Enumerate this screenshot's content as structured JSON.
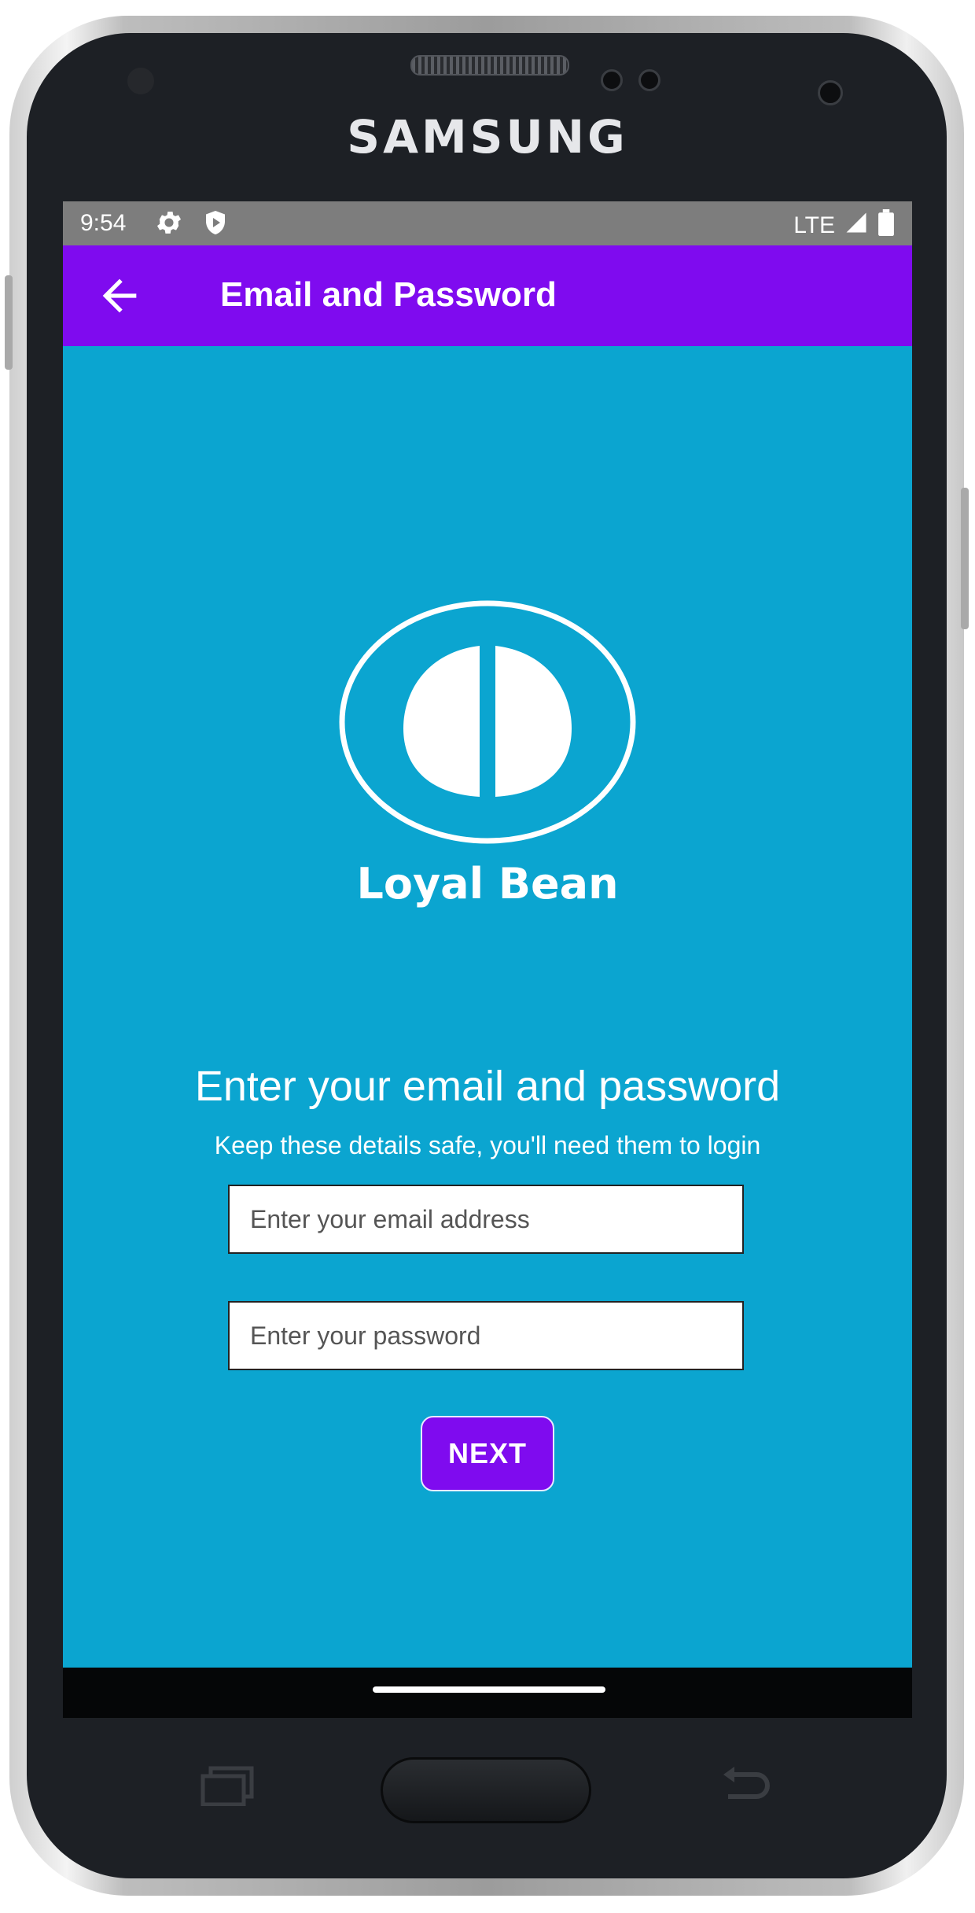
{
  "device": {
    "brand": "SAMSUNG"
  },
  "status_bar": {
    "time": "9:54",
    "network": "LTE",
    "icons": [
      "gear-icon",
      "shield-icon",
      "signal-icon",
      "battery-icon"
    ]
  },
  "app_bar": {
    "title": "Email and Password",
    "back_icon": "arrow-left-icon",
    "color": "#7f0bef"
  },
  "brand": {
    "name": "Loyal Bean",
    "logo_icon": "coffee-bean-logo"
  },
  "form": {
    "heading": "Enter your email and password",
    "subheading": "Keep these details safe, you'll need them to login",
    "email_placeholder": "Enter your email address",
    "email_value": "",
    "password_placeholder": "Enter your password",
    "password_value": "",
    "next_label": "NEXT"
  },
  "colors": {
    "background": "#0ba5d0",
    "accent": "#7f0bef"
  }
}
